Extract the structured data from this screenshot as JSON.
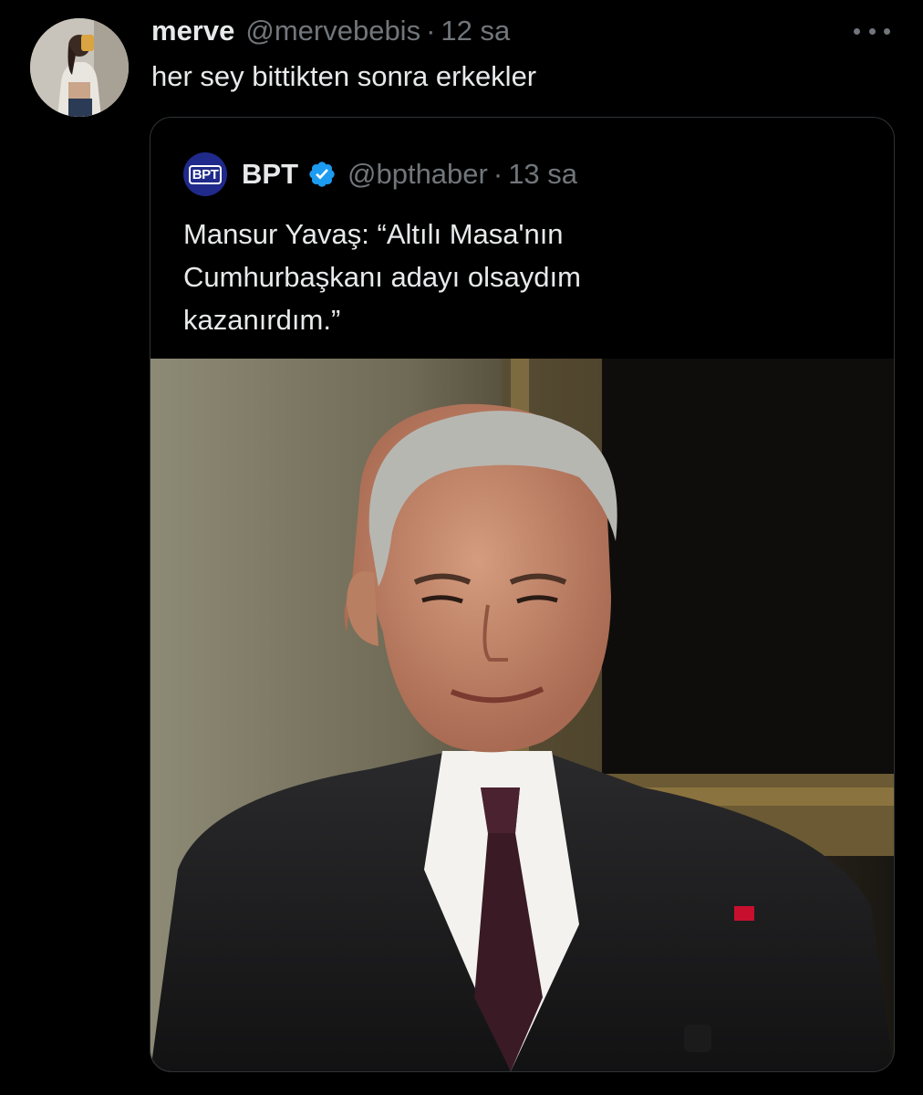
{
  "tweet": {
    "display_name": "merve",
    "handle": "@mervebebis",
    "separator": "·",
    "time": "12 sa",
    "text": "her sey bittikten sonra erkekler",
    "avatar_icon": "profile-photo"
  },
  "quoted": {
    "logo_text": "BPT",
    "display_name": "BPT",
    "verified": true,
    "handle": "@bpthaber",
    "separator": "·",
    "time": "13 sa",
    "text_lines": [
      "Mansur Yavaş: “Altılı Masa'nın",
      "Cumhurbaşkanı adayı olsaydım",
      "kazanırdım.”"
    ],
    "media_icon": "news-photo"
  },
  "colors": {
    "background": "#000000",
    "text_primary": "#e7e9ea",
    "text_secondary": "#71767b",
    "border": "#2f3336",
    "verified": "#1d9bf0",
    "logo_bg": "#1f2a8a"
  }
}
